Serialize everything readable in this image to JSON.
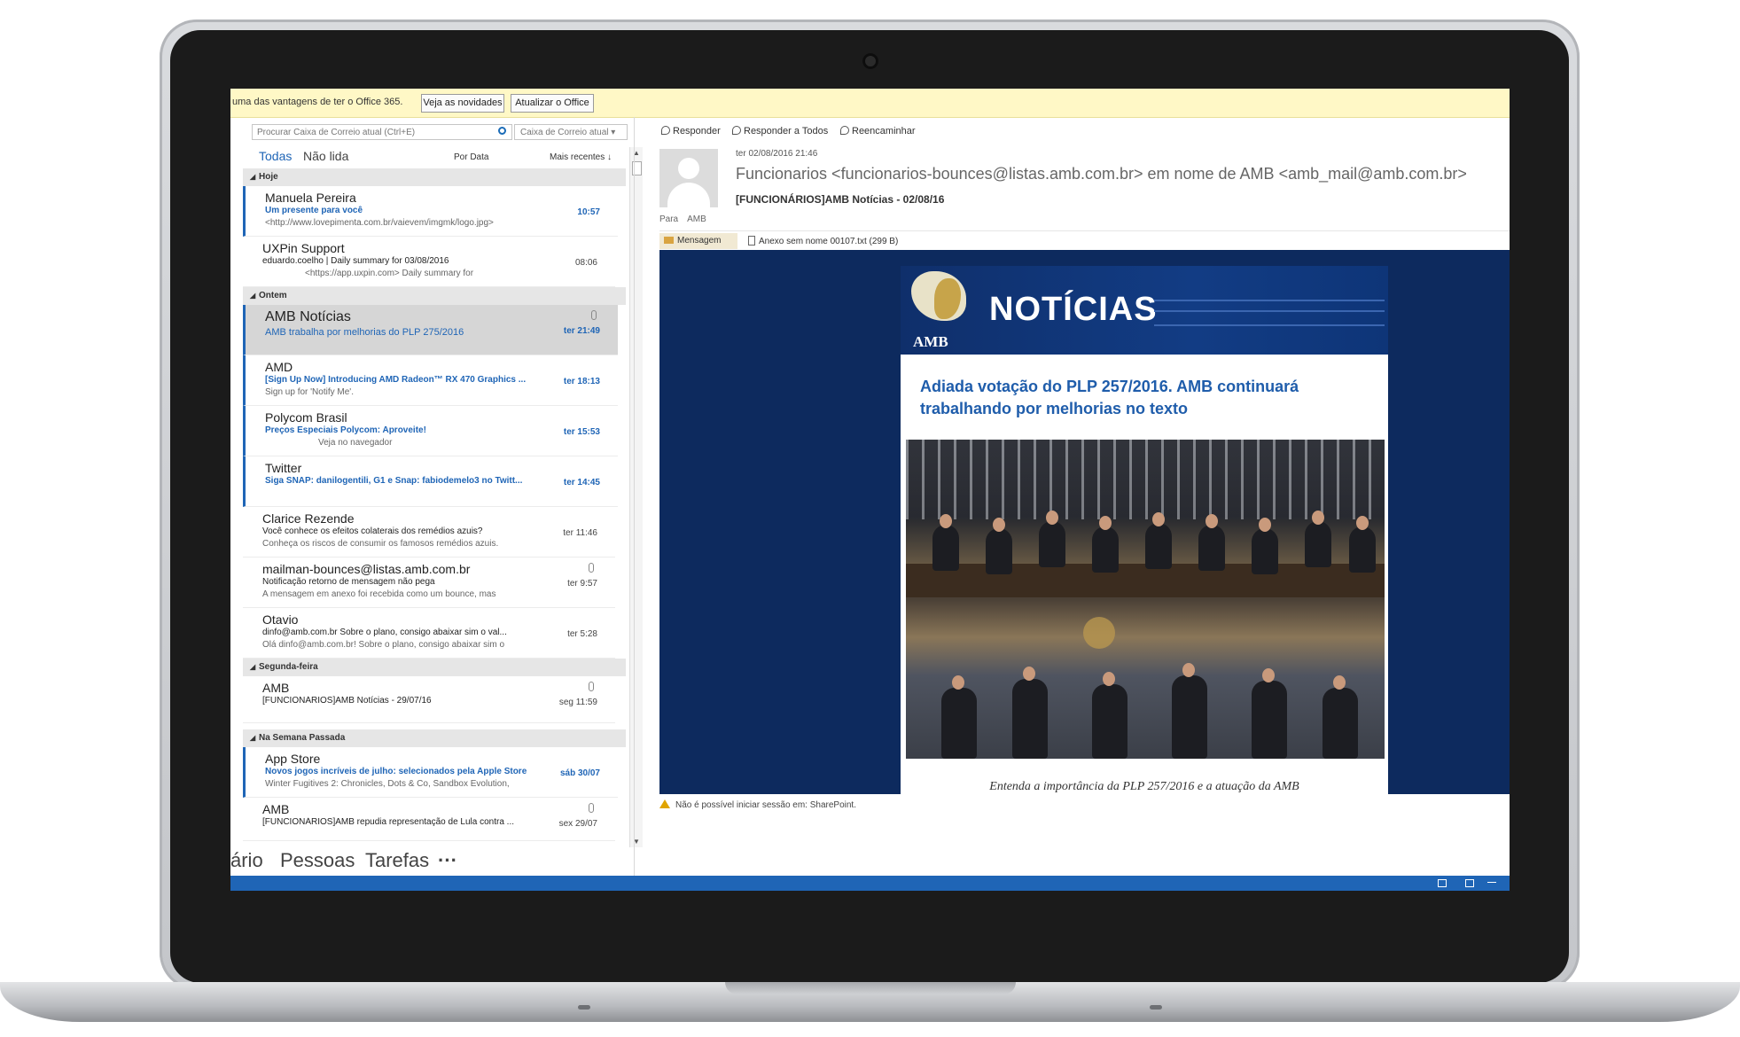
{
  "infobar": {
    "message": "uma das vantagens de ter o Office 365.",
    "buttons": [
      "Veja as novidades",
      "Atualizar o Office"
    ]
  },
  "mail_list": {
    "search_placeholder": "Procurar Caixa de Correio atual (Ctrl+E)",
    "search_scope": "Caixa de Correio atual",
    "filters": {
      "all": "Todas",
      "unread": "Não lida"
    },
    "sort": {
      "by": "Por Data",
      "order": "Mais recentes ↓"
    },
    "groups": [
      {
        "label": "Hoje"
      },
      {
        "label": "Ontem"
      },
      {
        "label": "Segunda-feira"
      },
      {
        "label": "Na Semana Passada"
      }
    ],
    "items": [
      {
        "sender": "Manuela Pereira",
        "subject": "Um presente para você",
        "preview": "<http://www.lovepimenta.com.br/vaievem/imgmk/logo.jpg>",
        "time": "10:57"
      },
      {
        "sender": "UXPin Support",
        "subject": "eduardo.coelho | Daily summary for 03/08/2016",
        "preview": "<https://app.uxpin.com>   Daily summary for",
        "time": "08:06"
      },
      {
        "sender": "AMB Notícias",
        "subject": "AMB trabalha por melhorias do PLP 275/2016",
        "preview": "",
        "time": "ter 21:49"
      },
      {
        "sender": "AMD",
        "subject": "[Sign Up Now] Introducing AMD Radeon™ RX 470 Graphics ...",
        "preview": "Sign up for 'Notify Me'.",
        "time": "ter 18:13"
      },
      {
        "sender": "Polycom Brasil",
        "subject": "Preços Especiais Polycom: Aproveite!",
        "preview": "Veja no navegador",
        "time": "ter 15:53"
      },
      {
        "sender": "Twitter",
        "subject": "Siga SNAP: danilogentili, G1 e Snap: fabiodemelo3 no Twitt...",
        "preview": "",
        "time": "ter 14:45"
      },
      {
        "sender": "Clarice Rezende",
        "subject": "Você conhece os efeitos colaterais dos remédios azuis?",
        "preview": "Conheça os riscos de consumir os famosos remédios azuis.",
        "time": "ter 11:46"
      },
      {
        "sender": "mailman-bounces@listas.amb.com.br",
        "subject": "Notificação retorno de mensagem não pega",
        "preview": "A mensagem em anexo foi recebida como um bounce, mas",
        "time": "ter 9:57"
      },
      {
        "sender": "Otavio",
        "subject": "dinfo@amb.com.br Sobre o plano, consigo abaixar sim o val...",
        "preview": "Olá dinfo@amb.com.br!  Sobre o plano, consigo abaixar sim o",
        "time": "ter 5:28"
      },
      {
        "sender": "AMB",
        "subject": "[FUNCIONÁRIOS]AMB Notícias - 29/07/16",
        "preview": "",
        "time": "seg 11:59"
      },
      {
        "sender": "App Store",
        "subject": "Novos jogos incríveis de julho: selecionados pela Apple Store",
        "preview": "Winter Fugitives 2: Chronicles, Dots & Co, Sandbox Evolution,",
        "time": "sáb 30/07"
      },
      {
        "sender": "AMB",
        "subject": "[FUNCIONÁRIOS]AMB repudia representação de Lula contra ...",
        "preview": "",
        "time": "sex 29/07"
      }
    ]
  },
  "navbar": {
    "items": [
      "ário",
      "Pessoas",
      "Tarefas",
      "···"
    ]
  },
  "reading": {
    "actions": [
      "Responder",
      "Responder a Todos",
      "Reencaminhar"
    ],
    "date": "ter 02/08/2016 21:46",
    "from": "Funcionarios <funcionarios-bounces@listas.amb.com.br> em nome de AMB <amb_mail@amb.com.br>",
    "subject": "[FUNCIONÁRIOS]AMB Notícias - 02/08/16",
    "to_label": "Para",
    "to": "AMB",
    "tab_message": "Mensagem",
    "attachment": "Anexo sem nome 00107.txt (299 B)",
    "newsletter": {
      "logo_text": "AMB",
      "title": "NOTÍCIAS",
      "headline": "Adiada votação do PLP 257/2016. AMB continuará trabalhando por melhorias no texto",
      "caption": "Entenda a importância da PLP 257/2016 e a atuação da AMB"
    },
    "warning": "Não é possível iniciar sessão em: SharePoint."
  },
  "colors": {
    "accent": "#1f65b6",
    "infobar": "#fff8c6",
    "newsletter_bg": "#0d2a5e"
  }
}
